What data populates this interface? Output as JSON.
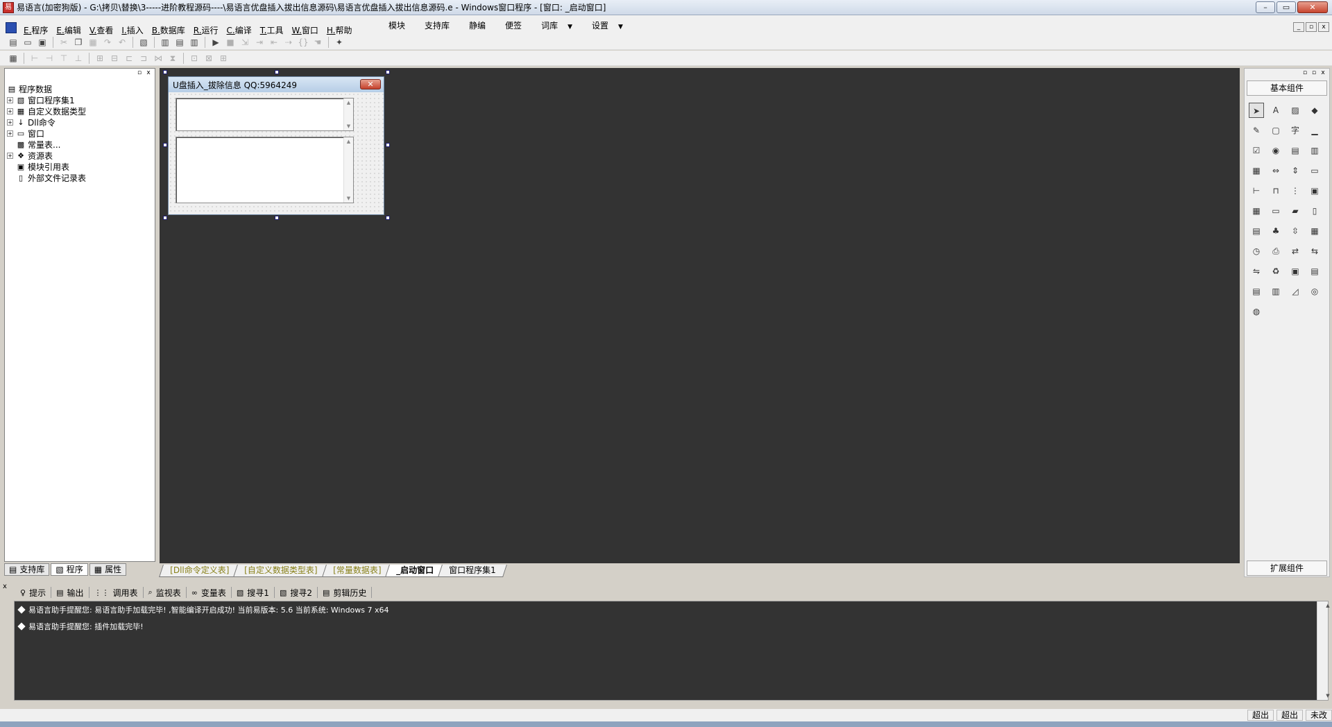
{
  "window": {
    "title": "易语言(加密狗版) - G:\\拷贝\\替换\\3-----进阶教程源码----\\易语言优盘插入拔出信息源码\\易语言优盘插入拔出信息源码.e - Windows窗口程序 - [窗口: _启动窗口]",
    "min_label": "–",
    "max_label": "▭",
    "close_label": "✕"
  },
  "menu": {
    "items": [
      "E.程序",
      "E.编辑",
      "V.查看",
      "I.插入",
      "B.数据库",
      "R.运行",
      "C.编译",
      "T.工具",
      "W.窗口",
      "H.帮助"
    ],
    "right_items": [
      "模块",
      "支持库",
      "静编",
      "便签",
      "词库",
      "设置"
    ],
    "dropdown_arrow": "▼"
  },
  "tree": {
    "root": "程序数据",
    "items": [
      {
        "label": "窗口程序集1",
        "expander": "+",
        "icon": "stack-icon"
      },
      {
        "label": "自定义数据类型",
        "expander": "+",
        "icon": "type-icon"
      },
      {
        "label": "Dll命令",
        "expander": "+",
        "icon": "dll-icon"
      },
      {
        "label": "窗口",
        "expander": "+",
        "icon": "window-icon"
      },
      {
        "label": "常量表...",
        "expander": "",
        "icon": "constant-icon"
      },
      {
        "label": "资源表",
        "expander": "+",
        "icon": "resource-icon"
      },
      {
        "label": "模块引用表",
        "expander": "",
        "icon": "module-icon"
      },
      {
        "label": "外部文件记录表",
        "expander": "",
        "icon": "file-icon"
      }
    ]
  },
  "left_tabs": [
    "支持库",
    "程序",
    "属性"
  ],
  "form": {
    "title": "U盘插入_拔除信息 QQ:5964249",
    "close_label": "✕"
  },
  "palette": {
    "header": "基本组件",
    "footer": "扩展组件"
  },
  "window_tabs": [
    "[Dll命令定义表]",
    "[自定义数据类型表]",
    "[常量数据表]",
    "_启动窗口",
    "窗口程序集1"
  ],
  "bottom_tabs": [
    "提示",
    "输出",
    "调用表",
    "监视表",
    "变量表",
    "搜寻1",
    "搜寻2",
    "剪辑历史"
  ],
  "output_lines": [
    "易语言助手提醒您: 易语言助手加载完毕! ,智能编译开启成功! 当前易版本: 5.6 当前系统: Windows 7 x64",
    "易语言助手提醒您: 插件加载完毕!"
  ],
  "status": [
    "超出",
    "超出",
    "未改"
  ]
}
